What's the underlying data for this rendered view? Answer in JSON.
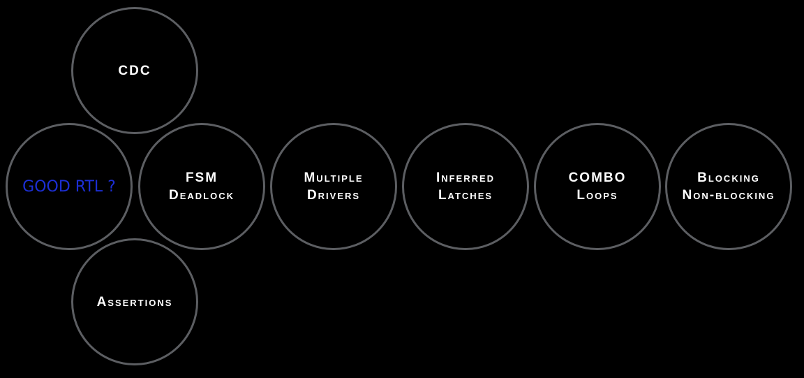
{
  "diagram": {
    "colors": {
      "background": "#000000",
      "circle_border": "#5c5e62",
      "label_text": "#ffffff",
      "center_text": "#1c2fd6"
    },
    "center": {
      "label": "GOOD RTL ?"
    },
    "top": {
      "line1": "CDC"
    },
    "bottom": {
      "line1": "Assertions"
    },
    "chain": [
      {
        "line1": "FSM",
        "line2": "Deadlock"
      },
      {
        "line1": "Multiple",
        "line2": "Drivers"
      },
      {
        "line1": "Inferred",
        "line2": "Latches"
      },
      {
        "line1": "COMBO",
        "line2": "Loops"
      },
      {
        "line1": "Blocking",
        "line2": "Non-blocking"
      }
    ]
  }
}
